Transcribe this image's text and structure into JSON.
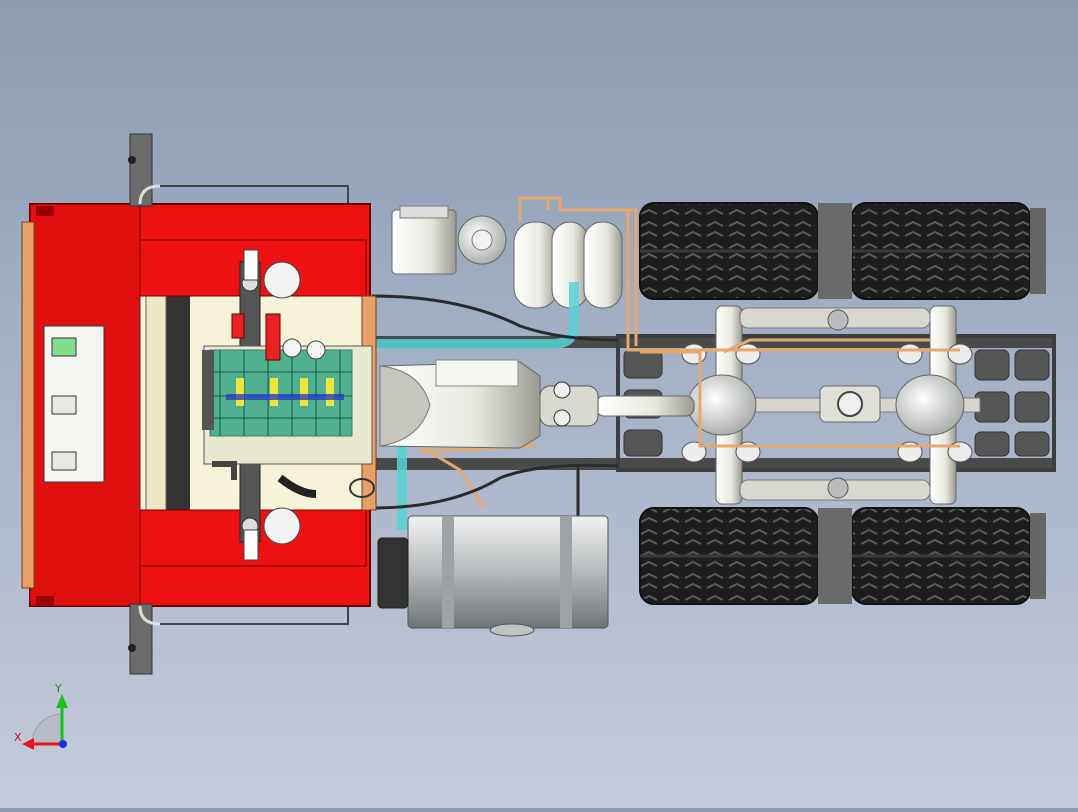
{
  "triad": {
    "x_label": "X",
    "y_label": "Y",
    "x_color": "#e8141b",
    "y_color": "#18c21b",
    "z_color": "#1a2ee0"
  },
  "colors": {
    "background_top": "#8a9bb3",
    "background_bottom": "#c5cbda",
    "cab_red": "#ee1111",
    "frame_gray": "#4a4a4a",
    "tire_dark": "#1c1c1c",
    "engine_bay": "#f7f3d8",
    "tank_silver": "#c8cccf",
    "air_line_orange": "#e6a86d",
    "coolant_cyan": "#56d2d6"
  },
  "icons": {
    "triad": "coordinate-triad-icon"
  }
}
